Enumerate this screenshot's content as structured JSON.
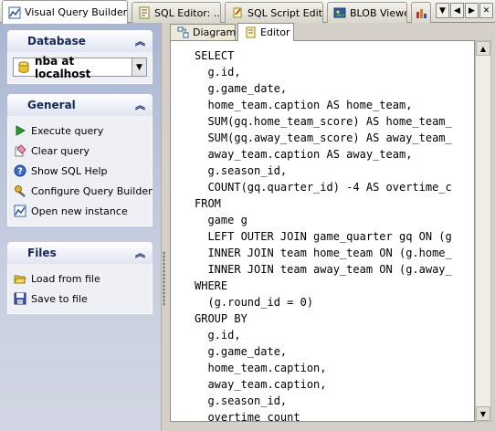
{
  "tabs": [
    {
      "label": "Visual Query Builder",
      "icon": "query-builder-icon",
      "active": true
    },
    {
      "label": "SQL Editor: ...",
      "icon": "sql-editor-icon"
    },
    {
      "label": "SQL Script Editor",
      "icon": "script-editor-icon"
    },
    {
      "label": "BLOB Viewer",
      "icon": "blob-viewer-icon"
    }
  ],
  "database": {
    "title": "Database",
    "selected": "nba at localhost"
  },
  "general": {
    "title": "General",
    "items": [
      {
        "label": "Execute query",
        "icon": "play-icon"
      },
      {
        "label": "Clear query",
        "icon": "clear-icon"
      },
      {
        "label": "Show SQL Help",
        "icon": "help-icon"
      },
      {
        "label": "Configure Query Builder",
        "icon": "configure-icon"
      },
      {
        "label": "Open new instance",
        "icon": "new-instance-icon"
      }
    ]
  },
  "files": {
    "title": "Files",
    "items": [
      {
        "label": "Load from file",
        "icon": "open-folder-icon"
      },
      {
        "label": "Save to file",
        "icon": "floppy-disk-icon"
      }
    ]
  },
  "subtabs": [
    {
      "label": "Diagram",
      "active": false
    },
    {
      "label": "Editor",
      "active": true
    }
  ],
  "sql_lines": [
    "SELECT",
    "  g.id,",
    "  g.game_date,",
    "  home_team.caption AS home_team,",
    "  SUM(gq.home_team_score) AS home_team_",
    "  SUM(gq.away_team_score) AS away_team_",
    "  away_team.caption AS away_team,",
    "  g.season_id,",
    "  COUNT(gq.quarter_id) -4 AS overtime_c",
    "FROM",
    "  game g",
    "  LEFT OUTER JOIN game_quarter gq ON (g",
    "  INNER JOIN team home_team ON (g.home_",
    "  INNER JOIN team away_team ON (g.away_",
    "WHERE",
    "  (g.round_id = 0)",
    "GROUP BY",
    "  g.id,",
    "  g.game_date,",
    "  home_team.caption,",
    "  away_team.caption,",
    "  g.season_id,",
    "  overtime_count"
  ]
}
